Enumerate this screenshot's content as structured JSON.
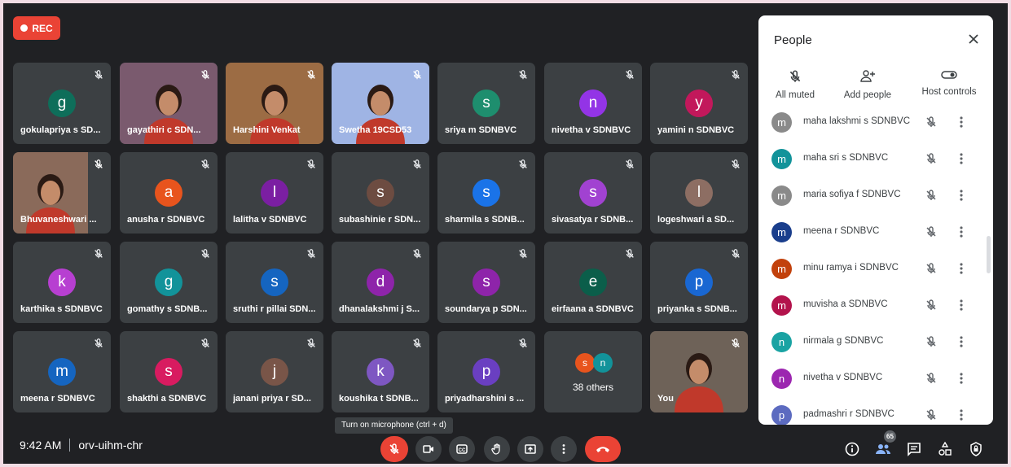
{
  "recording": {
    "label": "REC"
  },
  "tiles": [
    {
      "name": "gokulapriya s SD...",
      "initial": "g",
      "color": "#0e6e5a"
    },
    {
      "name": "gayathiri c SDN...",
      "video": true,
      "bg": "#7a5a6e"
    },
    {
      "name": "Harshini Venkat",
      "video": true,
      "bg": "#9c6c44"
    },
    {
      "name": "Swetha 19CSD53",
      "video": true,
      "bg": "#9fb4e4"
    },
    {
      "name": "sriya m SDNBVC",
      "initial": "s",
      "color": "#1e8e6e"
    },
    {
      "name": "nivetha v SDNBVC",
      "initial": "n",
      "color": "#9334e6"
    },
    {
      "name": "yamini n SDNBVC",
      "initial": "y",
      "color": "#c2185b"
    },
    {
      "name": "Bhuvaneshwari ...",
      "video": true,
      "bg": "#8a6a5a",
      "narrow": true
    },
    {
      "name": "anusha r SDNBVC",
      "initial": "a",
      "color": "#e8541d"
    },
    {
      "name": "lalitha v SDNBVC",
      "initial": "l",
      "color": "#7b1fa2"
    },
    {
      "name": "subashinie r SDN...",
      "initial": "s",
      "color": "#6d4c41"
    },
    {
      "name": "sharmila s SDNB...",
      "initial": "s",
      "color": "#1a73e8"
    },
    {
      "name": "sivasatya r SDNB...",
      "initial": "s",
      "color": "#a142d1"
    },
    {
      "name": "logeshwari a SD...",
      "initial": "l",
      "color": "#8d6e63"
    },
    {
      "name": "karthika s SDNBVC",
      "initial": "k",
      "color": "#b73fd1"
    },
    {
      "name": "gomathy s SDNB...",
      "initial": "g",
      "color": "#12939a"
    },
    {
      "name": "sruthi r pillai SDN...",
      "initial": "s",
      "color": "#1565c0"
    },
    {
      "name": "dhanalakshmi j S...",
      "initial": "d",
      "color": "#8e24aa"
    },
    {
      "name": "soundarya p SDN...",
      "initial": "s",
      "color": "#8e24aa"
    },
    {
      "name": "eirfaana a SDNBVC",
      "initial": "e",
      "color": "#0b5e4a"
    },
    {
      "name": "priyanka s SDNB...",
      "initial": "p",
      "color": "#1967d2"
    },
    {
      "name": "meena r SDNBVC",
      "initial": "m",
      "color": "#1565c0"
    },
    {
      "name": "shakthi a SDNBVC",
      "initial": "s",
      "color": "#d81b60"
    },
    {
      "name": "janani priya r SD...",
      "initial": "j",
      "color": "#795548"
    },
    {
      "name": "koushika t SDNB...",
      "initial": "k",
      "color": "#7e57c2"
    },
    {
      "name": "priyadharshini s ...",
      "initial": "p",
      "color": "#6a3fc1"
    },
    {
      "others": true,
      "count_label": "38 others",
      "initials": [
        {
          "letter": "s",
          "color": "#e8541d"
        },
        {
          "letter": "n",
          "color": "#12939a"
        }
      ]
    },
    {
      "name": "You",
      "video": true,
      "bg": "#6e6258",
      "self": true
    }
  ],
  "tooltip": "Turn on microphone (ctrl + d)",
  "meeting": {
    "time": "9:42 AM",
    "code": "orv-uihm-chr"
  },
  "participant_count": "65",
  "controls": [
    "mic-off",
    "camera",
    "captions",
    "raise-hand",
    "present",
    "more",
    "leave"
  ],
  "people_panel": {
    "title": "People",
    "actions": [
      {
        "label": "All muted",
        "icon": "mic-off-icon"
      },
      {
        "label": "Add people",
        "icon": "add-person-icon"
      },
      {
        "label": "Host controls",
        "icon": "toggle-icon"
      }
    ],
    "participants": [
      {
        "initial": "m",
        "name": "maha lakshmi s SDNBVC",
        "color": "#8a8a8a"
      },
      {
        "initial": "m",
        "name": "maha sri s SDNBVC",
        "color": "#12939a"
      },
      {
        "initial": "m",
        "name": "maria sofiya f SDNBVC",
        "color": "#8a8a8a"
      },
      {
        "initial": "m",
        "name": "meena r SDNBVC",
        "color": "#1a3e8c"
      },
      {
        "initial": "m",
        "name": "minu ramya i SDNBVC",
        "color": "#c2410c"
      },
      {
        "initial": "m",
        "name": "muvisha a SDNBVC",
        "color": "#b3134c"
      },
      {
        "initial": "n",
        "name": "nirmala g SDNBVC",
        "color": "#1aa3a3"
      },
      {
        "initial": "n",
        "name": "nivetha v SDNBVC",
        "color": "#9c27b0"
      },
      {
        "initial": "p",
        "name": "padmashri r SDNBVC",
        "color": "#5c6bc0"
      }
    ]
  },
  "colors": {
    "accent_red": "#ea4335",
    "background": "#202124",
    "tile": "#3c4043"
  }
}
